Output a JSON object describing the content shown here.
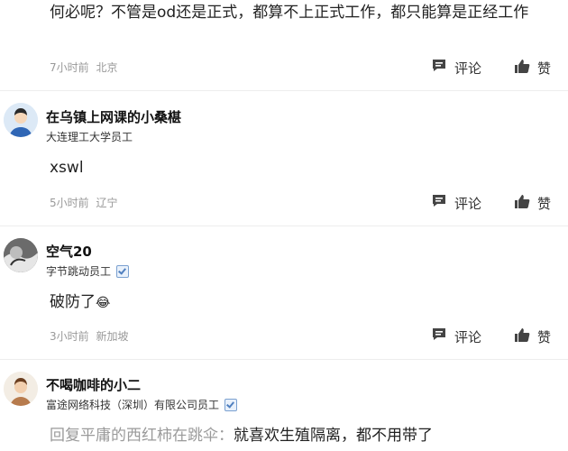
{
  "comments": [
    {
      "text": "何必呢？不管是od还是正式，都算不上正式工作，都只能算是正经工作",
      "time": "7小时前",
      "location": "北京",
      "comment_label": "评论",
      "like_label": "赞"
    },
    {
      "user_name": "在乌镇上网课的小桑椹",
      "user_title": "大连理工大学员工",
      "text": "xswl",
      "time": "5小时前",
      "location": "辽宁",
      "comment_label": "评论",
      "like_label": "赞"
    },
    {
      "user_name": "空气20",
      "user_title": "字节跳动员工",
      "text": "破防了",
      "emoji": "😂",
      "time": "3小时前",
      "location": "新加坡",
      "comment_label": "评论",
      "like_label": "赞"
    },
    {
      "user_name": "不喝咖啡的小二",
      "user_title": "富途网络科技（深圳）有限公司员工",
      "reply_prefix": "回复平庸的西红柿在跳伞：",
      "text": "就喜欢生殖隔离，都不用带了"
    }
  ],
  "colors": {
    "verified_border": "#7aa0d0",
    "meta_text": "#999999",
    "divider": "#ededed"
  },
  "icons": [
    "comment-icon",
    "like-icon",
    "verified-icon",
    "avatar"
  ]
}
